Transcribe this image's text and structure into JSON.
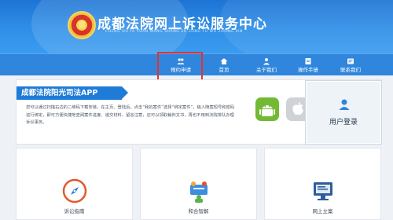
{
  "header": {
    "title": "成都法院网上诉讼服务中心",
    "subtitle": "CHENG DU FA YUAN WANG SHANG SU SONG FU WU ZHONG XIN"
  },
  "nav": {
    "items": [
      {
        "label": "预约申请",
        "icon": "users-icon"
      },
      {
        "label": "首页",
        "icon": "home-icon"
      },
      {
        "label": "关于我们",
        "icon": "people-icon"
      },
      {
        "label": "操作手册",
        "icon": "book-icon"
      },
      {
        "label": "联系我们",
        "icon": "contact-icon"
      }
    ],
    "highlight_color": "#e3322d"
  },
  "app_section": {
    "banner": "成都法院阳光司法APP",
    "description": "您可以通过扫描右边的二维码下载安装，在主页、登陆后，点击“我的案件”选择“绑定案件”，输入随案短号和密码进行绑定，即可方便快捷地查阅案件进度、递交材料、留言注意，还可以领取裁判文书，再也不用到法院排队办理诉讼事务。",
    "android_icon": "android-icon",
    "apple_icon": "apple-icon"
  },
  "login": {
    "label": "用户登录",
    "icon": "user-icon"
  },
  "services": [
    {
      "label": "诉讼指南",
      "icon": "compass-icon"
    },
    {
      "label": "和合智解",
      "icon": "mediation-icon"
    },
    {
      "label": "网上立案",
      "icon": "filing-icon"
    }
  ],
  "colors": {
    "header": "#2f8fe8",
    "nav": "#2f86dc",
    "accent": "#1f7bd8"
  }
}
